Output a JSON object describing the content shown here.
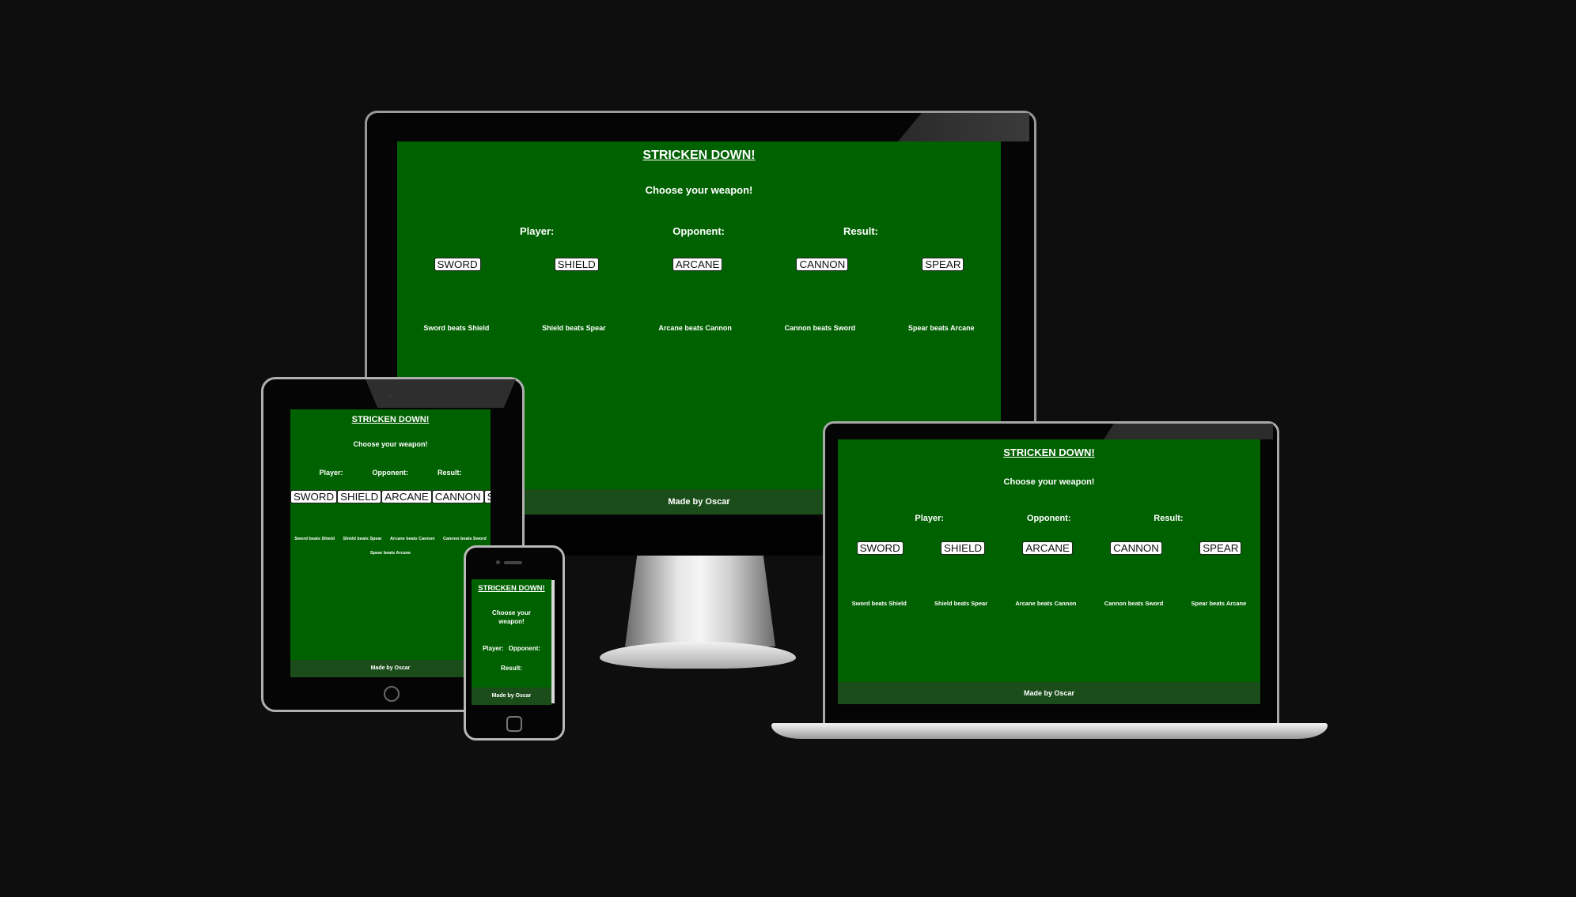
{
  "app": {
    "title": "STRICKEN DOWN!",
    "prompt": "Choose your weapon!",
    "labels": {
      "player": "Player:",
      "opponent": "Opponent:",
      "result": "Result:"
    },
    "weapons": [
      "SWORD",
      "SHIELD",
      "ARCANE",
      "CANNON",
      "SPEAR"
    ],
    "rules": [
      "Sword beats Shield",
      "Shield beats Spear",
      "Arcane beats Cannon",
      "Cannon beats Sword",
      "Spear beats Arcane"
    ],
    "footer": "Made by Oscar"
  },
  "phone": {
    "prompt_line1": "Choose your",
    "prompt_line2": "weapon!"
  },
  "colors": {
    "background": "#0e0e0e",
    "screen_green": "#006100",
    "footer_green": "#1b4d1b",
    "text": "#ffffff"
  }
}
